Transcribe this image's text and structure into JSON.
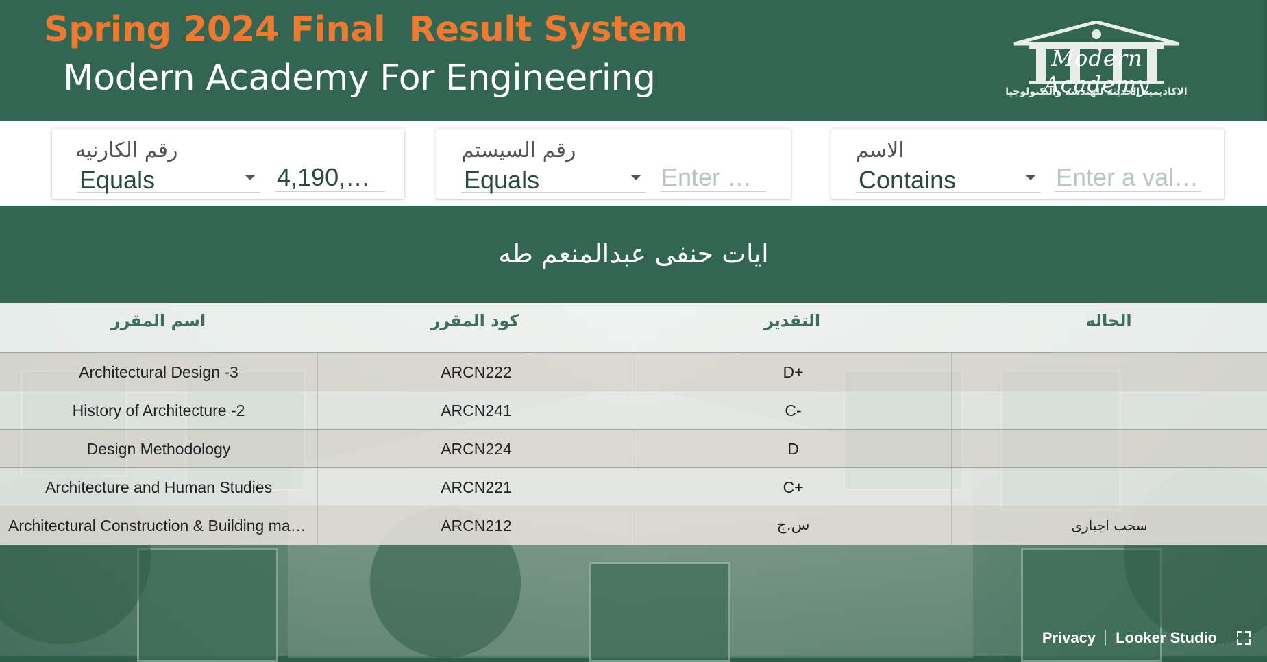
{
  "header": {
    "title": "Spring 2024 Final  Result System",
    "subtitle": "Modern Academy For Engineering",
    "logo": {
      "script_text": "Modern Academy",
      "caption": "الاكاديمية الحديثة للهندسة والتكنولوجيا"
    }
  },
  "filters": [
    {
      "label": "رقم الكارنيه",
      "operator": "Equals",
      "value": "4,190,1…",
      "placeholder": ""
    },
    {
      "label": "رقم السيستم",
      "operator": "Equals",
      "value": "",
      "placeholder": "Enter a …"
    },
    {
      "label": "الاسم",
      "operator": "Contains",
      "value": "",
      "placeholder": "Enter a val…"
    }
  ],
  "student": {
    "name": "ايات حنفى عبدالمنعم طه"
  },
  "table": {
    "headers": {
      "course_name": "اسم المقرر",
      "course_code": "كود المقرر",
      "grade": "التقدير",
      "status": "الحاله"
    },
    "rows": [
      {
        "course_name": "Architectural Design -3",
        "course_code": "ARCN222",
        "grade": "D+",
        "status": ""
      },
      {
        "course_name": "History of Architecture -2",
        "course_code": "ARCN241",
        "grade": "C-",
        "status": ""
      },
      {
        "course_name": "Design Methodology",
        "course_code": "ARCN224",
        "grade": "D",
        "status": ""
      },
      {
        "course_name": "Architecture and Human Studies",
        "course_code": "ARCN221",
        "grade": "C+",
        "status": ""
      },
      {
        "course_name": "Architectural Construction & Building mater…",
        "course_code": "ARCN212",
        "grade": "س.ج",
        "status": "سحب اجبارى"
      }
    ]
  },
  "footer": {
    "privacy": "Privacy",
    "brand": "Looker Studio",
    "fullscreen_icon": "fullscreen-icon"
  },
  "colors": {
    "header_bg": "#336652",
    "title_orange": "#ee7a32",
    "column_header_text": "#3f6e5b"
  }
}
